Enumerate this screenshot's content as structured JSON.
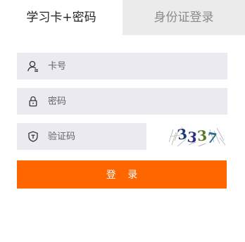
{
  "tabs": {
    "active": "学习卡+密码",
    "inactive": "身份证登录"
  },
  "form": {
    "card_placeholder": "卡号",
    "password_placeholder": "密码",
    "code_placeholder": "验证码",
    "captcha_text": "3337",
    "login_label": "登 录"
  },
  "icons": {
    "card": "user-icon",
    "password": "lock-icon",
    "code": "shield-icon"
  },
  "colors": {
    "accent": "#ff6600",
    "field_bg": "#ebeaf0",
    "inactive_tab_bg": "#ebebeb"
  }
}
